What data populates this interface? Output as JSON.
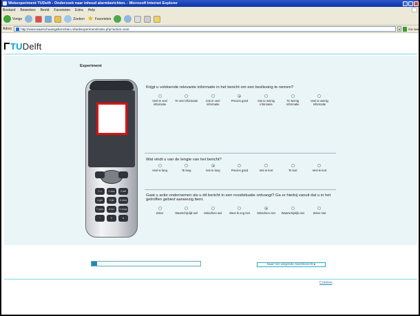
{
  "window": {
    "title": "Webexperiment TUDelft - Onderzoek naar inhoud alarmberichten. - Microsoft Internet Explorer"
  },
  "menu": [
    "Bestand",
    "Bewerken",
    "Beeld",
    "Favorieten",
    "Extra",
    "Help"
  ],
  "toolbar": {
    "back_label": "Vorige",
    "search_label": "Zoeken",
    "favorites_label": "Favorieten"
  },
  "address": {
    "label": "Adres",
    "url": "http://www.waarschuwingsberichten.nl/webexperiment/index.php?action=next",
    "go_label": "Ga naar"
  },
  "brand": {
    "tu": "TU",
    "delft": "Delft"
  },
  "page": {
    "section_title": "Experiment",
    "progress_fraction": 0.05,
    "next_button": "Naar het volgende Alarmbericht",
    "colofon": "Colofon"
  },
  "questions": [
    {
      "text": "Krijgt u voldoende relevante informatie in het bericht om een beslissing te nemen?",
      "options": [
        "Veel te veel informatie",
        "Te veel informatie",
        "Iets te veel informatie",
        "Precies goed",
        "Iets te weinig informatie",
        "Te weinig informatie",
        "Veel te weinig informatie"
      ],
      "selected_index": 3
    },
    {
      "text": "Wat vindt u van de lengte van het bericht?",
      "options": [
        "Veel te lang",
        "Te lang",
        "Iets te lang",
        "Precies goed",
        "Iets te kort",
        "Te kort",
        "Veel te kort"
      ],
      "selected_index": 2
    },
    {
      "text": "Gaat u actie ondernemen als u dit bericht in een noodsituatie ontvangt? Ga er hierbij vanuit dat u in het getroffen gebied aanwezig bent.",
      "options": [
        "Zeker",
        "Waarschijnlijk wel",
        "Misschien wel",
        "Weet ik nog niet",
        "Misschien niet",
        "Waarschijnlijk niet",
        "Zeker niet"
      ],
      "selected_index": 4
    }
  ],
  "phone_keys": [
    "1 o",
    "2 abc",
    "3 def",
    "4 ghi",
    "5 jkl",
    "6 mno",
    "7 pqrs",
    "8 tuv",
    "9 wxyz",
    "*",
    "0",
    "#"
  ]
}
